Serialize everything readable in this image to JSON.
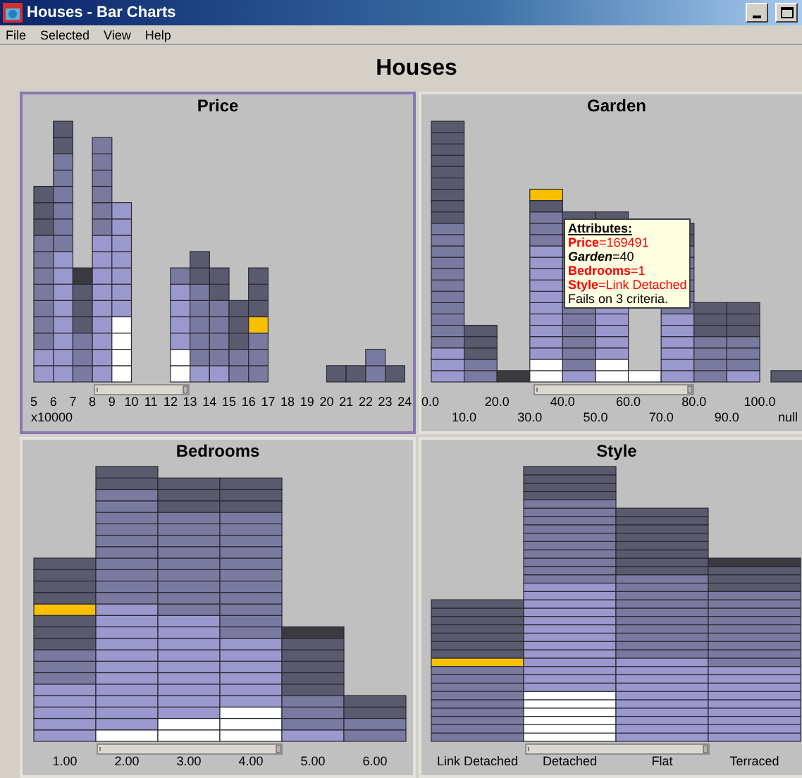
{
  "window": {
    "title": "Houses - Bar Charts"
  },
  "menu": [
    "File",
    "Selected",
    "View",
    "Help"
  ],
  "heading": "Houses",
  "panels": [
    {
      "title": "Price",
      "selected": true,
      "labels": [
        "5",
        "6",
        "7",
        "8",
        "9",
        "10",
        "11",
        "12",
        "13",
        "14",
        "15",
        "16",
        "17",
        "18",
        "19",
        "20",
        "21",
        "22",
        "23",
        "24"
      ],
      "unit": "x10000"
    },
    {
      "title": "Garden",
      "selected": false,
      "labels": [
        "0.0",
        "10.0",
        "20.0",
        "30.0",
        "40.0",
        "50.0",
        "60.0",
        "70.0",
        "80.0",
        "90.0",
        "100.0",
        "null"
      ],
      "tooltip": {
        "heading": "Attributes:",
        "lines": [
          {
            "name": "Price",
            "value": "=169491",
            "failed": true
          },
          {
            "name": "Garden",
            "value": "=40",
            "failed": false
          },
          {
            "name": "Bedrooms",
            "value": "=1",
            "failed": true
          },
          {
            "name": "Style",
            "value": "=Link Detached",
            "failed": true
          }
        ],
        "summary": "Fails on 3 criteria."
      }
    },
    {
      "title": "Bedrooms",
      "selected": false,
      "labels": [
        "1.00",
        "2.00",
        "3.00",
        "4.00",
        "5.00",
        "6.00"
      ]
    },
    {
      "title": "Style",
      "selected": false,
      "labels": [
        "Link Detached",
        "Detached",
        "Flat",
        "Terraced"
      ]
    }
  ]
}
